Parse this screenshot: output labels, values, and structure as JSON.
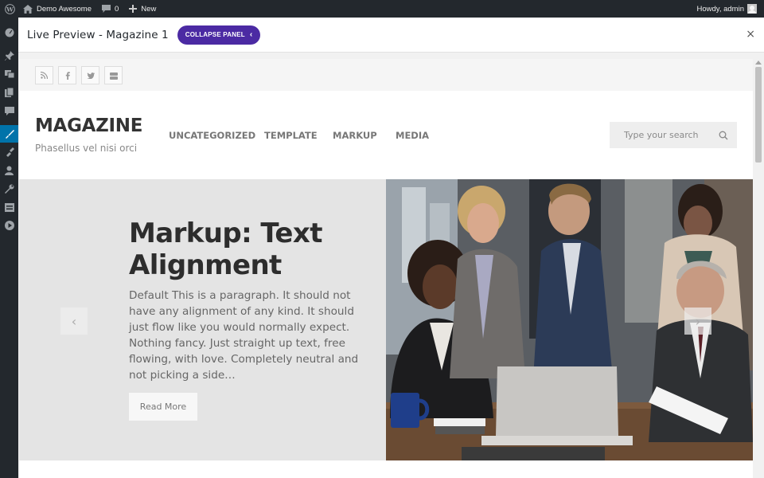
{
  "admin_bar": {
    "site_name": "Demo Awesome",
    "comments_count": "0",
    "new_label": "New",
    "greeting": "Howdy, admin"
  },
  "admin_menu": {
    "icons": [
      "dashboard-icon",
      "pin-icon",
      "media-icon",
      "pages-icon",
      "comments-icon",
      "appearance-icon",
      "plugins-icon",
      "users-icon",
      "tools-icon",
      "settings-icon",
      "play-icon"
    ],
    "active": "appearance-icon",
    "active_color": "#0073aa"
  },
  "customizer": {
    "title": "Live Preview - Magazine 1",
    "collapse_label": "COLLAPSE PANEL",
    "collapse_color": "#4b2aa3"
  },
  "preview": {
    "social_icons": [
      "rss-icon",
      "facebook-icon",
      "twitter-icon",
      "youtube-icon"
    ],
    "site_title": "MAGAZINE",
    "site_description": "Phasellus vel nisi orci",
    "nav": [
      "UNCATEGORIZED",
      "TEMPLATE",
      "MARKUP",
      "MEDIA"
    ],
    "search_placeholder": "Type your search",
    "slide": {
      "title": "Markup: Text Alignment",
      "excerpt": "Default This is a paragraph. It should not have any alignment of any kind. It should just flow like you would normally expect. Nothing fancy. Just straight up text, free flowing, with love. Completely neutral and not picking a side…",
      "read_more": "Read More"
    }
  }
}
